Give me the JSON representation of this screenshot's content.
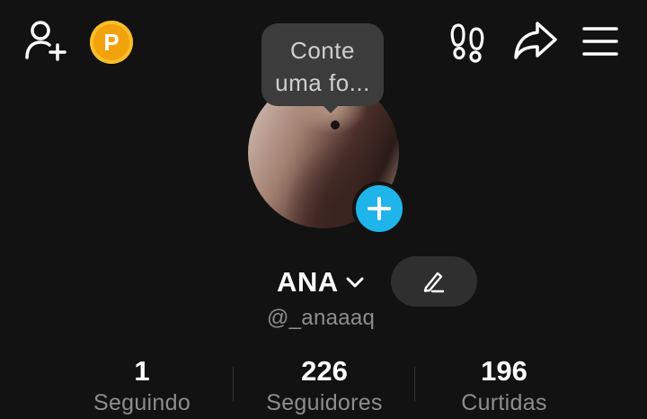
{
  "topbar": {
    "add_user_icon": "person-plus-icon",
    "coin_label": "P",
    "coin_color": "#f2a20c",
    "footprints_icon": "footprints-icon",
    "share_icon": "share-arrow-icon",
    "menu_icon": "hamburger-menu-icon"
  },
  "story_tooltip": {
    "line1": "Conte",
    "line2": "uma fo..."
  },
  "profile": {
    "name": "ANA",
    "handle": "@_anaaaq",
    "add_badge_color": "#20b5ea"
  },
  "stats": [
    {
      "value": "1",
      "label": "Seguindo"
    },
    {
      "value": "226",
      "label": "Seguidores"
    },
    {
      "value": "196",
      "label": "Curtidas"
    }
  ]
}
